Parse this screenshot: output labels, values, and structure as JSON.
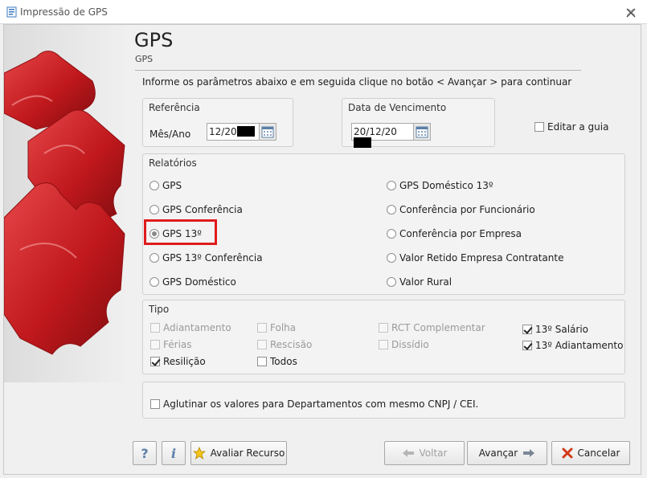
{
  "window": {
    "title": "Impressão de GPS",
    "close_icon": "close-icon"
  },
  "header": {
    "title": "GPS",
    "subtitle": "GPS",
    "instruction": "Informe os parâmetros abaixo e em seguida clique no botão < Avançar > para continuar"
  },
  "referencia": {
    "group_label": "Referência",
    "field_label": "Mês/Ano",
    "value": "12/20"
  },
  "vencimento": {
    "group_label": "Data de Vencimento",
    "value": "20/12/20"
  },
  "editar_guia": {
    "label": "Editar a guia",
    "checked": false
  },
  "relatorios": {
    "group_label": "Relatórios",
    "selected": "GPS 13º",
    "left": [
      "GPS",
      "GPS Conferência",
      "GPS 13º",
      "GPS 13º Conferência",
      "GPS Doméstico"
    ],
    "right": [
      "GPS Doméstico 13º",
      "Conferência por Funcionário",
      "Conferência por Empresa",
      "Valor Retido Empresa Contratante",
      "Valor Rural"
    ]
  },
  "tipo": {
    "group_label": "Tipo",
    "items": [
      {
        "label": "Adiantamento",
        "checked": false,
        "enabled": false
      },
      {
        "label": "Férias",
        "checked": false,
        "enabled": false
      },
      {
        "label": "Resilição",
        "checked": true,
        "enabled": true
      },
      {
        "label": "Folha",
        "checked": false,
        "enabled": false
      },
      {
        "label": "Rescisão",
        "checked": false,
        "enabled": false
      },
      {
        "label": "Todos",
        "checked": false,
        "enabled": true
      },
      {
        "label": "RCT Complementar",
        "checked": false,
        "enabled": false
      },
      {
        "label": "Dissídio",
        "checked": false,
        "enabled": false
      },
      {
        "label": "13º Salário",
        "checked": true,
        "enabled": true
      },
      {
        "label": "13º Adiantamento",
        "checked": true,
        "enabled": true
      }
    ]
  },
  "aglutinar": {
    "label": "Aglutinar os valores para Departamentos com mesmo CNPJ / CEI.",
    "checked": false
  },
  "buttons": {
    "help": "?",
    "info": "i",
    "avaliar": "Avaliar Recurso",
    "voltar": "Voltar",
    "avancar": "Avançar",
    "cancelar": "Cancelar"
  },
  "colors": {
    "highlight": "#e01b1b",
    "puzzle": "#c0181c"
  }
}
